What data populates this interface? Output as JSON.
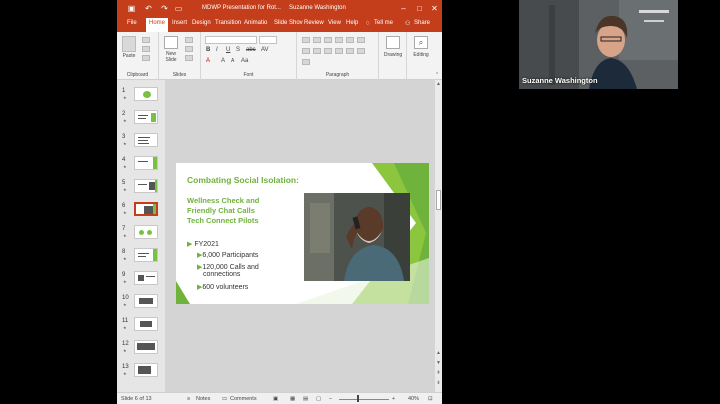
{
  "titlebar": {
    "document_title": "MDWP Presentation for Rot...",
    "user_name": "Suzanne Washington"
  },
  "tabs": [
    "File",
    "Home",
    "Insert",
    "Design",
    "Transition",
    "Animatio",
    "Slide Shov",
    "Review",
    "View",
    "Help"
  ],
  "tell_me": "Tell me",
  "share": "Share",
  "ribbon": {
    "paste": "Paste",
    "new_slide": "New\nSlide",
    "drawing": "Drawing",
    "editing": "Editing",
    "groups": {
      "clipboard": "Clipboard",
      "slides": "Slides",
      "font": "Font",
      "paragraph": "Paragraph"
    }
  },
  "thumbnails": [
    {
      "num": "1",
      "selected": false
    },
    {
      "num": "2",
      "selected": false
    },
    {
      "num": "3",
      "selected": false
    },
    {
      "num": "4",
      "selected": false
    },
    {
      "num": "5",
      "selected": false
    },
    {
      "num": "6",
      "selected": true
    },
    {
      "num": "7",
      "selected": false
    },
    {
      "num": "8",
      "selected": false
    },
    {
      "num": "9",
      "selected": false
    },
    {
      "num": "10",
      "selected": false
    },
    {
      "num": "11",
      "selected": false
    },
    {
      "num": "12",
      "selected": false
    },
    {
      "num": "13",
      "selected": false
    }
  ],
  "slide": {
    "title": "Combating Social Isolation:",
    "subtitles": [
      "Wellness Check and",
      "Friendly Chat Calls",
      "Tech Connect Pilots"
    ],
    "bullet_main": "FY2021",
    "bullets": [
      "6,000 Participants",
      "120,000 Calls and",
      "connections",
      "600 volunteers"
    ]
  },
  "status": {
    "slide_counter": "Slide 6 of 13",
    "notes": "Notes",
    "comments": "Comments",
    "zoom": "40%"
  },
  "webcam": {
    "participant_name": "Suzanne Washington"
  },
  "colors": {
    "ppt_accent": "#c43e1c",
    "slide_green": "#6fb23c"
  }
}
